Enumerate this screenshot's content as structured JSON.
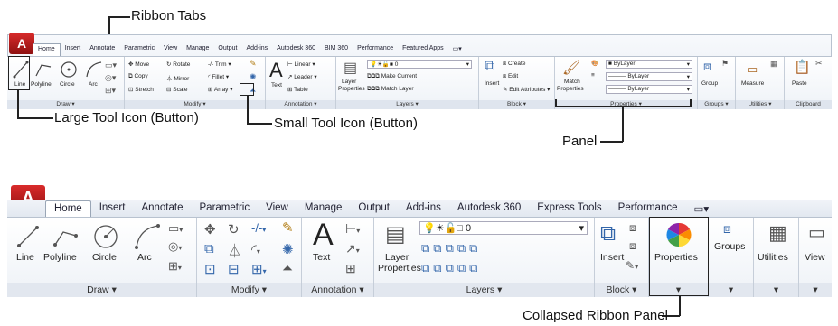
{
  "annotations": {
    "ribbon_tabs": "Ribbon Tabs",
    "large_tool_icon": "Large Tool Icon (Button)",
    "small_tool_icon": "Small Tool Icon (Button)",
    "panel": "Panel",
    "collapsed_panel": "Collapsed Ribbon Panel"
  },
  "ribbon_top": {
    "tabs": [
      "Home",
      "Insert",
      "Annotate",
      "Parametric",
      "View",
      "Manage",
      "Output",
      "Add-ins",
      "Autodesk 360",
      "BIM 360",
      "Performance",
      "Featured Apps"
    ],
    "draw": {
      "title": "Draw",
      "line": "Line",
      "polyline": "Polyline",
      "circle": "Circle",
      "arc": "Arc"
    },
    "modify": {
      "title": "Modify",
      "move": "Move",
      "rotate": "Rotate",
      "trim": "Trim",
      "copy": "Copy",
      "mirror": "Mirror",
      "fillet": "Fillet",
      "stretch": "Stretch",
      "scale": "Scale",
      "array": "Array"
    },
    "annotation": {
      "title": "Annotation",
      "text": "Text",
      "linear": "Linear",
      "leader": "Leader",
      "table": "Table"
    },
    "layers": {
      "title": "Layers",
      "layer_properties_1": "Layer",
      "layer_properties_2": "Properties",
      "layer_value": "0",
      "make_current": "Make Current",
      "match_layer": "Match Layer"
    },
    "block": {
      "title": "Block",
      "insert": "Insert",
      "create": "Create",
      "edit": "Edit",
      "edit_attributes": "Edit Attributes"
    },
    "properties": {
      "title": "Properties",
      "match_1": "Match",
      "match_2": "Properties",
      "bylayer1": "ByLayer",
      "bylayer2": "ByLayer",
      "bylayer3": "ByLayer"
    },
    "groups": {
      "title": "Groups",
      "group": "Group"
    },
    "utilities": {
      "title": "Utilities",
      "measure": "Measure"
    },
    "clipboard": {
      "title": "Clipboard",
      "paste": "Paste"
    }
  },
  "ribbon_bottom": {
    "tabs": [
      "Home",
      "Insert",
      "Annotate",
      "Parametric",
      "View",
      "Manage",
      "Output",
      "Add-ins",
      "Autodesk 360",
      "Express Tools",
      "Performance"
    ],
    "draw": {
      "title": "Draw",
      "line": "Line",
      "polyline": "Polyline",
      "circle": "Circle",
      "arc": "Arc"
    },
    "modify": {
      "title": "Modify"
    },
    "annotation": {
      "title": "Annotation",
      "text": "Text"
    },
    "layers": {
      "title": "Layers",
      "layer_properties_1": "Layer",
      "layer_properties_2": "Properties",
      "layer_value": "0"
    },
    "block": {
      "title": "Block",
      "insert": "Insert"
    },
    "properties": {
      "title": "Properties"
    },
    "groups": {
      "title": "Groups"
    },
    "utilities": {
      "title": "Utilities"
    },
    "view": {
      "title": "View"
    }
  }
}
